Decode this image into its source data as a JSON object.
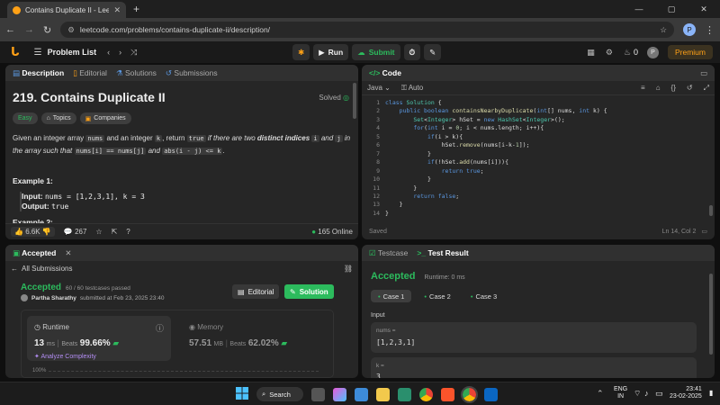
{
  "browser": {
    "tab_title": "Contains Duplicate II - LeetCode",
    "url": "leetcode.com/problems/contains-duplicate-ii/description/",
    "avatar": "P"
  },
  "lc": {
    "problem_list": "Problem List",
    "run": "Run",
    "submit": "Submit",
    "streak": "0",
    "avatar": "P",
    "premium": "Premium"
  },
  "left": {
    "tabs": [
      "Description",
      "Editorial",
      "Solutions",
      "Submissions"
    ],
    "title": "219. Contains Duplicate II",
    "solved": "Solved",
    "tags": [
      "Easy",
      "Topics",
      "Companies"
    ],
    "desc_1": "Given an integer array",
    "desc_nums": "nums",
    "desc_2": "and an integer",
    "desc_k": "k",
    "desc_3": ", return",
    "desc_true": "true",
    "desc_4": "if there are two",
    "desc_bold": "distinct indices",
    "desc_i": "i",
    "desc_and": "and",
    "desc_j": "j",
    "desc_5": "in the array such that",
    "desc_eq": "nums[i] == nums[j]",
    "desc_and2": "and",
    "desc_abs": "abs(i - j) <= k",
    "desc_end": ".",
    "example1": "Example 1:",
    "input_label": "Input:",
    "input_val": "nums = [1,2,3,1], k = 3",
    "output_label": "Output:",
    "output_val": "true",
    "example2": "Example 2:",
    "likes": "6.6K",
    "comments": "267",
    "online": "165 Online"
  },
  "code": {
    "title": "Code",
    "lang": "Java",
    "auto": "Auto",
    "saved": "Saved",
    "pos": "Ln 14, Col 2",
    "line_numbers": [
      "1",
      "2",
      "3",
      "4",
      "5",
      "6",
      "7",
      "8",
      "9",
      "10",
      "11",
      "12",
      "13",
      "14"
    ]
  },
  "accepted": {
    "tab": "Accepted",
    "all": "All Submissions",
    "status": "Accepted",
    "passed": "60 / 60 testcases passed",
    "user": "Partha Sharathy",
    "submitted": "submitted at Feb 23, 2025 23:40",
    "editorial": "Editorial",
    "solution": "Solution",
    "runtime_label": "Runtime",
    "runtime_val": "13",
    "runtime_unit": "ms",
    "beats": "Beats",
    "runtime_pct": "99.66%",
    "analyze": "Analyze Complexity",
    "memory_label": "Memory",
    "memory_val": "57.51",
    "memory_unit": "MB",
    "memory_pct": "62.02%",
    "chart_tick": "100%"
  },
  "result": {
    "testcase_tab": "Testcase",
    "result_tab": "Test Result",
    "status": "Accepted",
    "runtime": "Runtime: 0 ms",
    "cases": [
      "Case 1",
      "Case 2",
      "Case 3"
    ],
    "input": "Input",
    "nums_label": "nums =",
    "nums_val": "[1,2,3,1]",
    "k_label": "k =",
    "k_val": "3"
  },
  "taskbar": {
    "search": "Search",
    "lang1": "ENG",
    "lang2": "IN",
    "time": "23:41",
    "date": "23-02-2025"
  },
  "colors": {
    "accent_orange": "#ffa116",
    "green": "#2cbb5d",
    "blue": "#5a97e0"
  }
}
